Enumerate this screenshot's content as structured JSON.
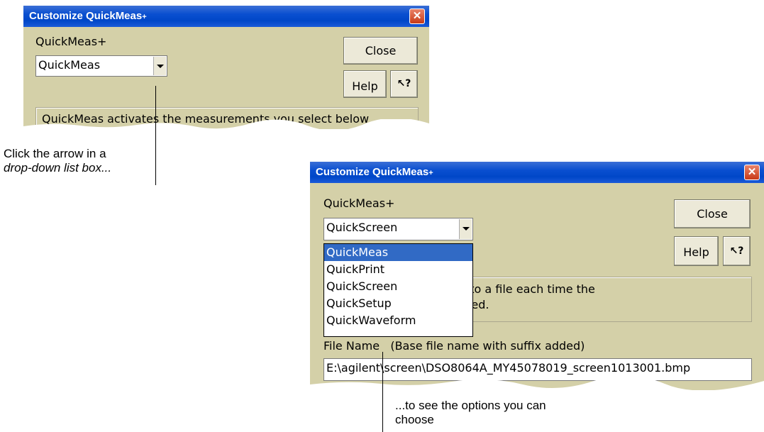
{
  "dialog1": {
    "title": "Customize QuickMeas",
    "title_suffix": "+",
    "close_x": "✕",
    "group_label": "QuickMeas+",
    "combo_value": "QuickMeas",
    "close_button": "Close",
    "help_button": "Help",
    "whats_this_button": "↖?",
    "description": "QuickMeas activates the measurements you select below"
  },
  "dialog2": {
    "title": "Customize QuickMeas",
    "title_suffix": "+",
    "close_x": "✕",
    "group_label": "QuickMeas+",
    "combo_value": "QuickScreen",
    "close_button": "Close",
    "help_button": "Help",
    "whats_this_button": "↖?",
    "description_line1": "Saves the screen image to a file each time the",
    "description_line2": "QuickMeas+ key is pressed.",
    "options": [
      "QuickMeas",
      "QuickPrint",
      "QuickScreen",
      "QuickSetup",
      "QuickWaveform"
    ],
    "selected_index": 0,
    "file_name_label": "File Name",
    "file_name_hint": "(Base file name with suffix added)",
    "file_name_value": "E:\\agilent\\screen\\DSO8064A_MY45078019_screen1013001.bmp"
  },
  "callouts": {
    "left_line1": "Click the arrow in a",
    "left_line2": "drop-down list box...",
    "bottom_line1": "...to see the options you can",
    "bottom_line2": "choose"
  },
  "colors": {
    "dialog_bg": "#d4d0a8",
    "titlebar": "#0047c8",
    "selection": "#316ac5",
    "close_x": "#c83a17"
  }
}
